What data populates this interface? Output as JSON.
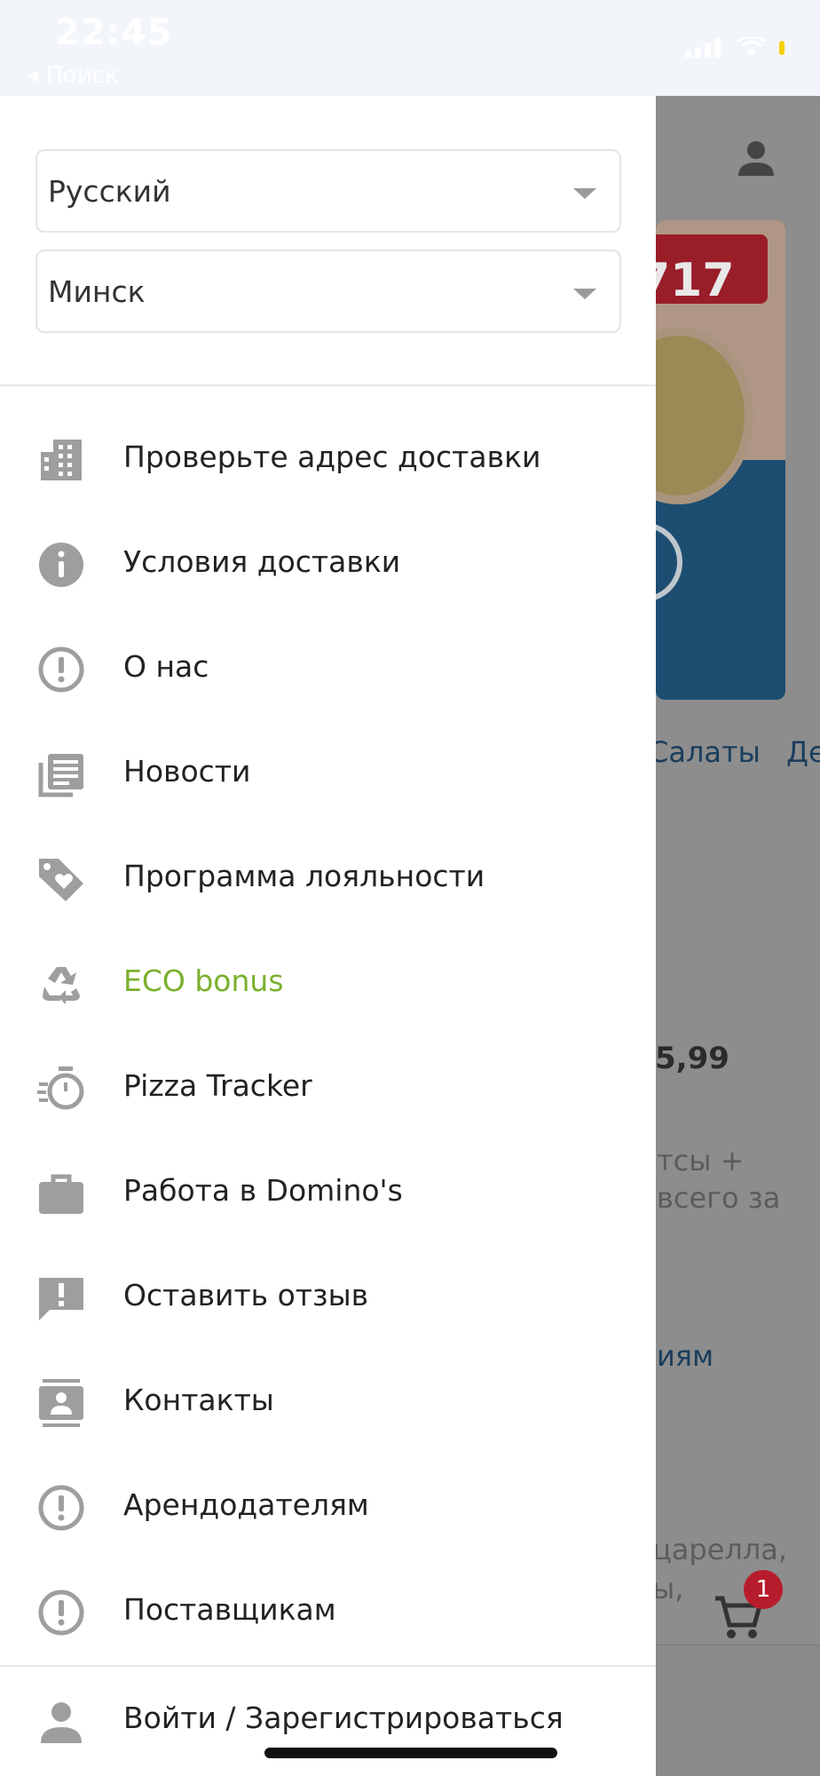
{
  "status_bar": {
    "time": "22:45",
    "back_app": "◂ Поиск"
  },
  "drawer": {
    "language_select": {
      "value": "Русский"
    },
    "city_select": {
      "value": "Минск"
    },
    "menu": [
      {
        "label": "Проверьте адрес доставки",
        "icon": "building-icon"
      },
      {
        "label": "Условия доставки",
        "icon": "info-icon"
      },
      {
        "label": "О нас",
        "icon": "exclamation-circle-icon"
      },
      {
        "label": "Новости",
        "icon": "news-icon"
      },
      {
        "label": "Программа лояльности",
        "icon": "tag-heart-icon"
      },
      {
        "label": "ECO bonus",
        "icon": "recycle-icon",
        "color": "#7ab02d"
      },
      {
        "label": "Pizza Tracker",
        "icon": "timer-icon"
      },
      {
        "label": "Работа в Domino's",
        "icon": "briefcase-icon"
      },
      {
        "label": "Оставить отзыв",
        "icon": "feedback-icon"
      },
      {
        "label": "Контакты",
        "icon": "contacts-icon"
      },
      {
        "label": "Арендодателям",
        "icon": "exclamation-circle-icon"
      },
      {
        "label": "Поставщикам",
        "icon": "exclamation-circle-icon"
      }
    ],
    "login": {
      "label": "Войти / Зарегистрироваться",
      "icon": "person-icon"
    }
  },
  "background": {
    "banner_number": "717",
    "category_salads": "Салаты",
    "category_next": "Де",
    "price": "5,99",
    "desc_line1": "тсы +",
    "desc_line2": "всего за",
    "link_text": "иям",
    "ingredients_line1": "царелла,",
    "ingredients_line2": "ы,",
    "cart_count": "1"
  },
  "colors": {
    "accent_eco": "#7ab02d",
    "icon_gray": "#9e9e9e",
    "badge_red": "#b71c2c"
  }
}
